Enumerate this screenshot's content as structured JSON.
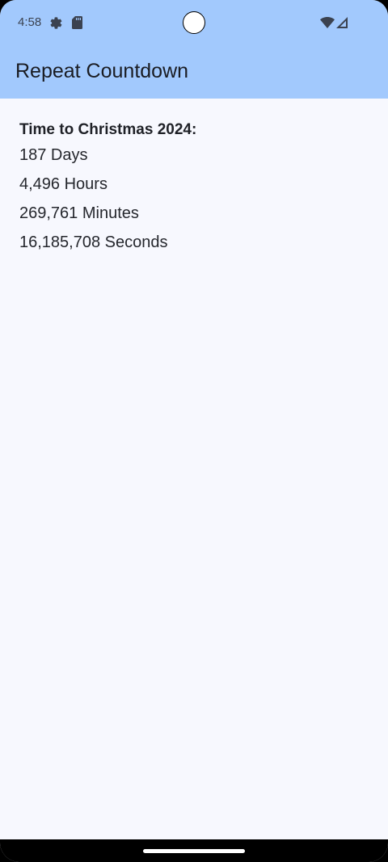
{
  "status_bar": {
    "time": "4:58",
    "icons": [
      "settings-gear-icon",
      "sd-card-icon",
      "wifi-icon",
      "cellular-signal-icon"
    ]
  },
  "app_bar": {
    "title": "Repeat Countdown",
    "color": "#a2c9fd"
  },
  "countdown": {
    "heading": "Time to Christmas 2024:",
    "lines": [
      "187 Days",
      "4,496 Hours",
      "269,761 Minutes",
      "16,185,708 Seconds"
    ]
  }
}
